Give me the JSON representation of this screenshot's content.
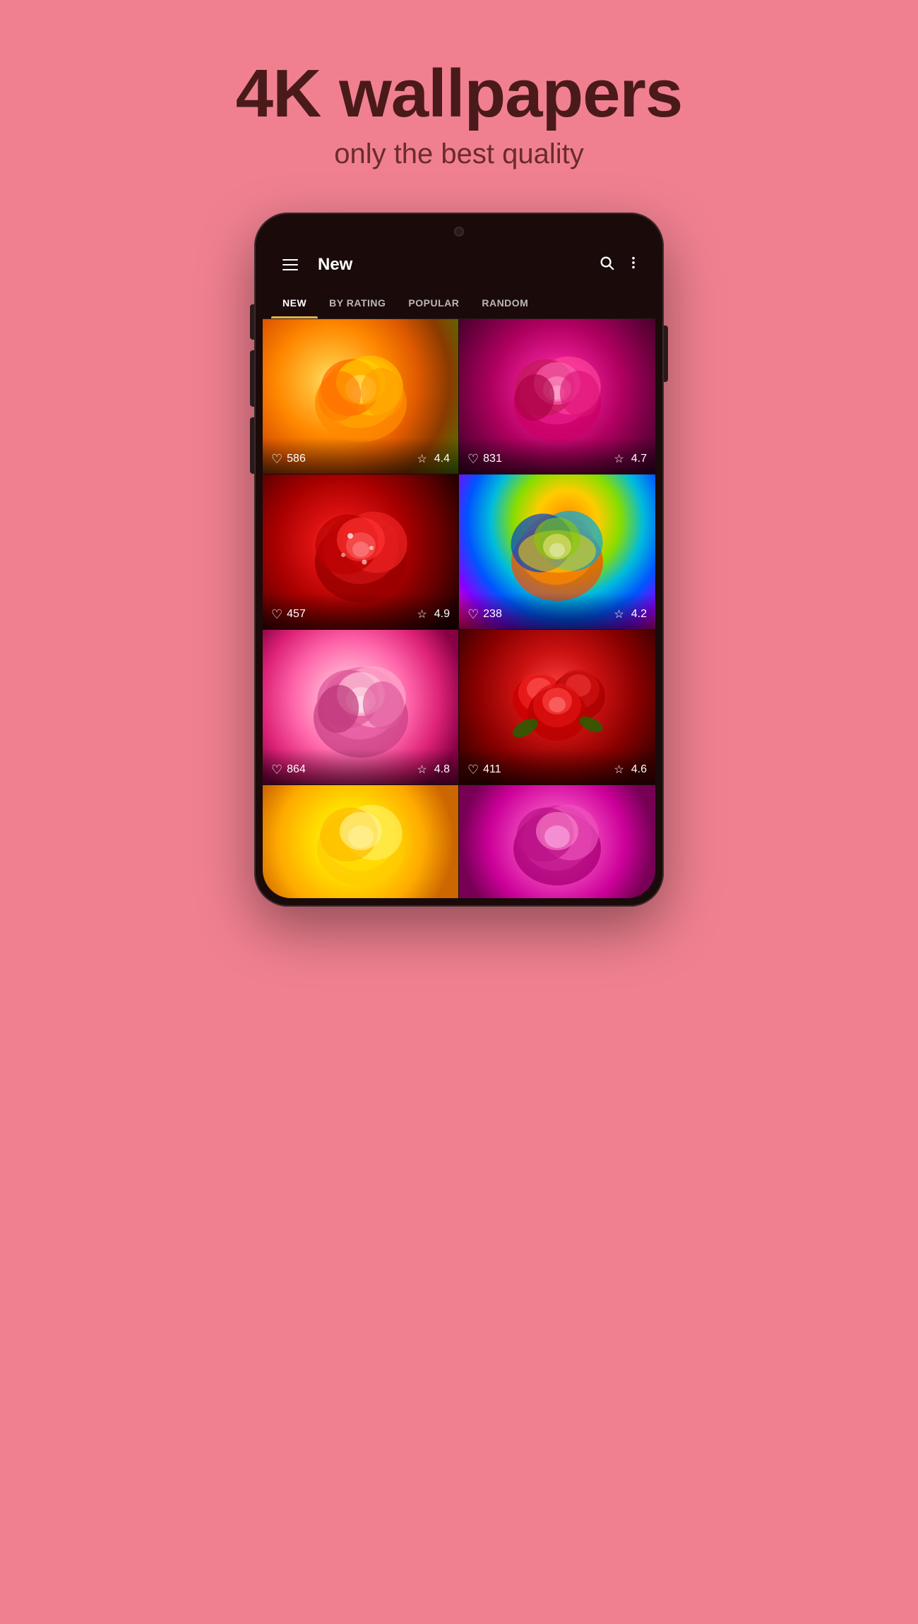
{
  "header": {
    "title": "4K wallpapers",
    "subtitle": "only the best quality"
  },
  "app": {
    "topbar": {
      "title": "New",
      "search_icon": "search",
      "menu_icon": "menu",
      "more_icon": "more-vertical"
    },
    "tabs": [
      {
        "label": "NEW",
        "active": true
      },
      {
        "label": "BY RATING",
        "active": false
      },
      {
        "label": "POPULAR",
        "active": false
      },
      {
        "label": "RANDOM",
        "active": false
      }
    ],
    "wallpapers": [
      {
        "likes": "586",
        "rating": "4.4",
        "color": "orange-rose"
      },
      {
        "likes": "831",
        "rating": "4.7",
        "color": "pink-dark-rose"
      },
      {
        "likes": "457",
        "rating": "4.9",
        "color": "red-rose"
      },
      {
        "likes": "238",
        "rating": "4.2",
        "color": "rainbow-rose"
      },
      {
        "likes": "864",
        "rating": "4.8",
        "color": "light-pink-rose"
      },
      {
        "likes": "411",
        "rating": "4.6",
        "color": "red-bouquet-rose"
      },
      {
        "likes": "",
        "rating": "",
        "color": "yellow-rose"
      },
      {
        "likes": "",
        "rating": "",
        "color": "purple-rose"
      }
    ]
  },
  "colors": {
    "background": "#f08090",
    "title": "#4a1a1a",
    "subtitle": "#6b2b2b",
    "phone_body": "#1a0a0a",
    "tab_active_indicator": "#e8b040"
  }
}
